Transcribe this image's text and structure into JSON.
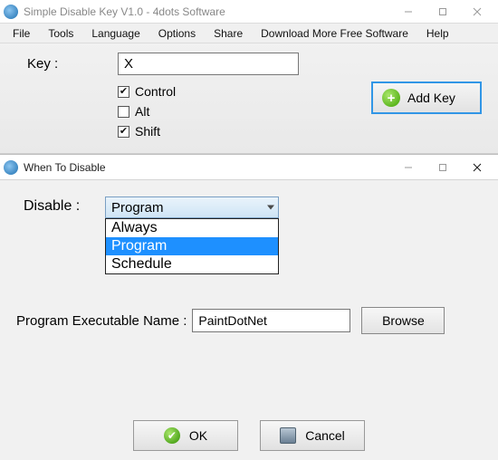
{
  "window1": {
    "title": "Simple Disable Key V1.0 - 4dots Software",
    "menu": [
      "File",
      "Tools",
      "Language",
      "Options",
      "Share",
      "Download More Free Software",
      "Help"
    ],
    "key_label": "Key :",
    "key_value": "X",
    "modifiers": {
      "control": {
        "label": "Control",
        "checked": true
      },
      "alt": {
        "label": "Alt",
        "checked": false
      },
      "shift": {
        "label": "Shift",
        "checked": true
      }
    },
    "add_key_label": "Add Key"
  },
  "window2": {
    "title": "When To Disable",
    "disable_label": "Disable :",
    "disable_value": "Program",
    "options": [
      "Always",
      "Program",
      "Schedule"
    ],
    "selected_option": "Program",
    "exe_label": "Program Executable Name :",
    "exe_value": "PaintDotNet",
    "browse_label": "Browse",
    "ok_label": "OK",
    "cancel_label": "Cancel"
  }
}
